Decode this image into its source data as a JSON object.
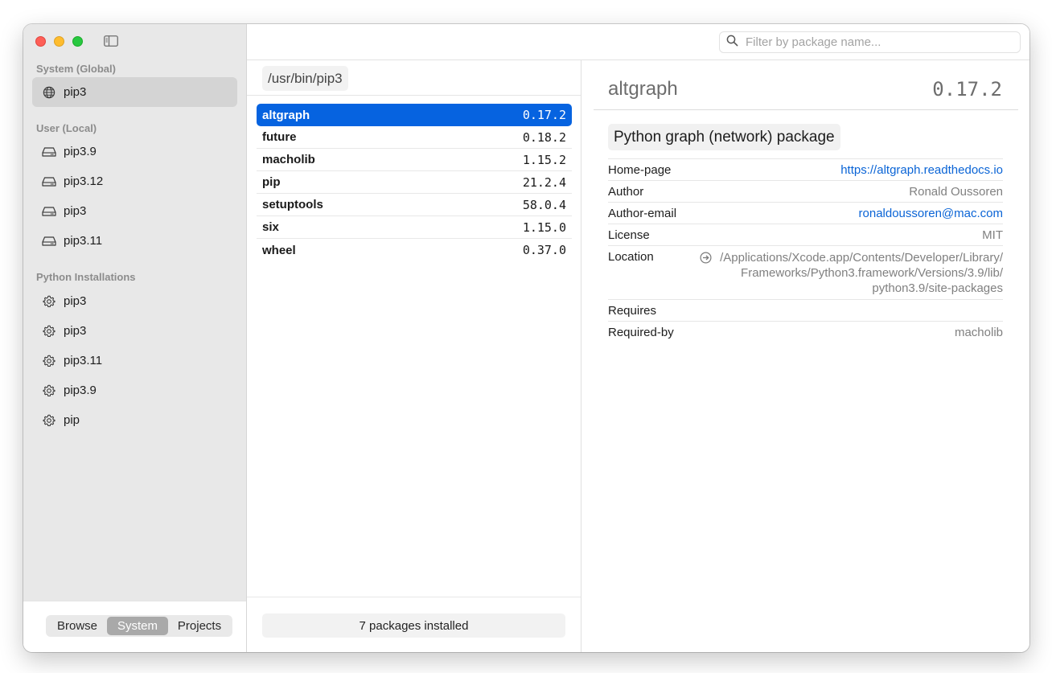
{
  "sidebar": {
    "sections": [
      {
        "header": "System (Global)"
      },
      {
        "header": "User (Local)"
      },
      {
        "header": "Python Installations"
      }
    ],
    "system_items": [
      {
        "label": "pip3",
        "icon": "globe-icon",
        "selected": true
      }
    ],
    "user_items": [
      {
        "label": "pip3.9",
        "icon": "drive-icon"
      },
      {
        "label": "pip3.12",
        "icon": "drive-icon"
      },
      {
        "label": "pip3",
        "icon": "drive-icon"
      },
      {
        "label": "pip3.11",
        "icon": "drive-icon"
      }
    ],
    "python_items": [
      {
        "label": "pip3",
        "icon": "gear-icon"
      },
      {
        "label": "pip3",
        "icon": "gear-icon"
      },
      {
        "label": "pip3.11",
        "icon": "gear-icon"
      },
      {
        "label": "pip3.9",
        "icon": "gear-icon"
      },
      {
        "label": "pip",
        "icon": "gear-icon"
      }
    ],
    "segments": [
      "Browse",
      "System",
      "Projects"
    ],
    "active_segment": "System"
  },
  "toolbar": {
    "search_placeholder": "Filter by package name..."
  },
  "middle": {
    "path": "/usr/bin/pip3",
    "packages": [
      {
        "name": "altgraph",
        "version": "0.17.2",
        "selected": true
      },
      {
        "name": "future",
        "version": "0.18.2"
      },
      {
        "name": "macholib",
        "version": "1.15.2"
      },
      {
        "name": "pip",
        "version": "21.2.4"
      },
      {
        "name": "setuptools",
        "version": "58.0.4"
      },
      {
        "name": "six",
        "version": "1.15.0"
      },
      {
        "name": "wheel",
        "version": "0.37.0"
      }
    ],
    "status": "7 packages installed"
  },
  "detail": {
    "name": "altgraph",
    "version": "0.17.2",
    "summary": "Python graph (network) package",
    "properties": {
      "homepage_key": "Home-page",
      "homepage_val": "https://altgraph.readthedocs.io",
      "author_key": "Author",
      "author_val": "Ronald Oussoren",
      "email_key": "Author-email",
      "email_val": "ronaldoussoren@mac.com",
      "license_key": "License",
      "license_val": "MIT",
      "location_key": "Location",
      "location_line1": "/Applications/Xcode.app/Contents/Developer/Library/",
      "location_line2": "Frameworks/Python3.framework/Versions/3.9/lib/",
      "location_line3": "python3.9/site-packages",
      "requires_key": "Requires",
      "requires_val": "",
      "requiredby_key": "Required-by",
      "requiredby_val": "macholib"
    }
  },
  "colors": {
    "accent": "#0663e0",
    "link": "#0a64d6",
    "sidebar_bg": "#e8e8e8"
  }
}
